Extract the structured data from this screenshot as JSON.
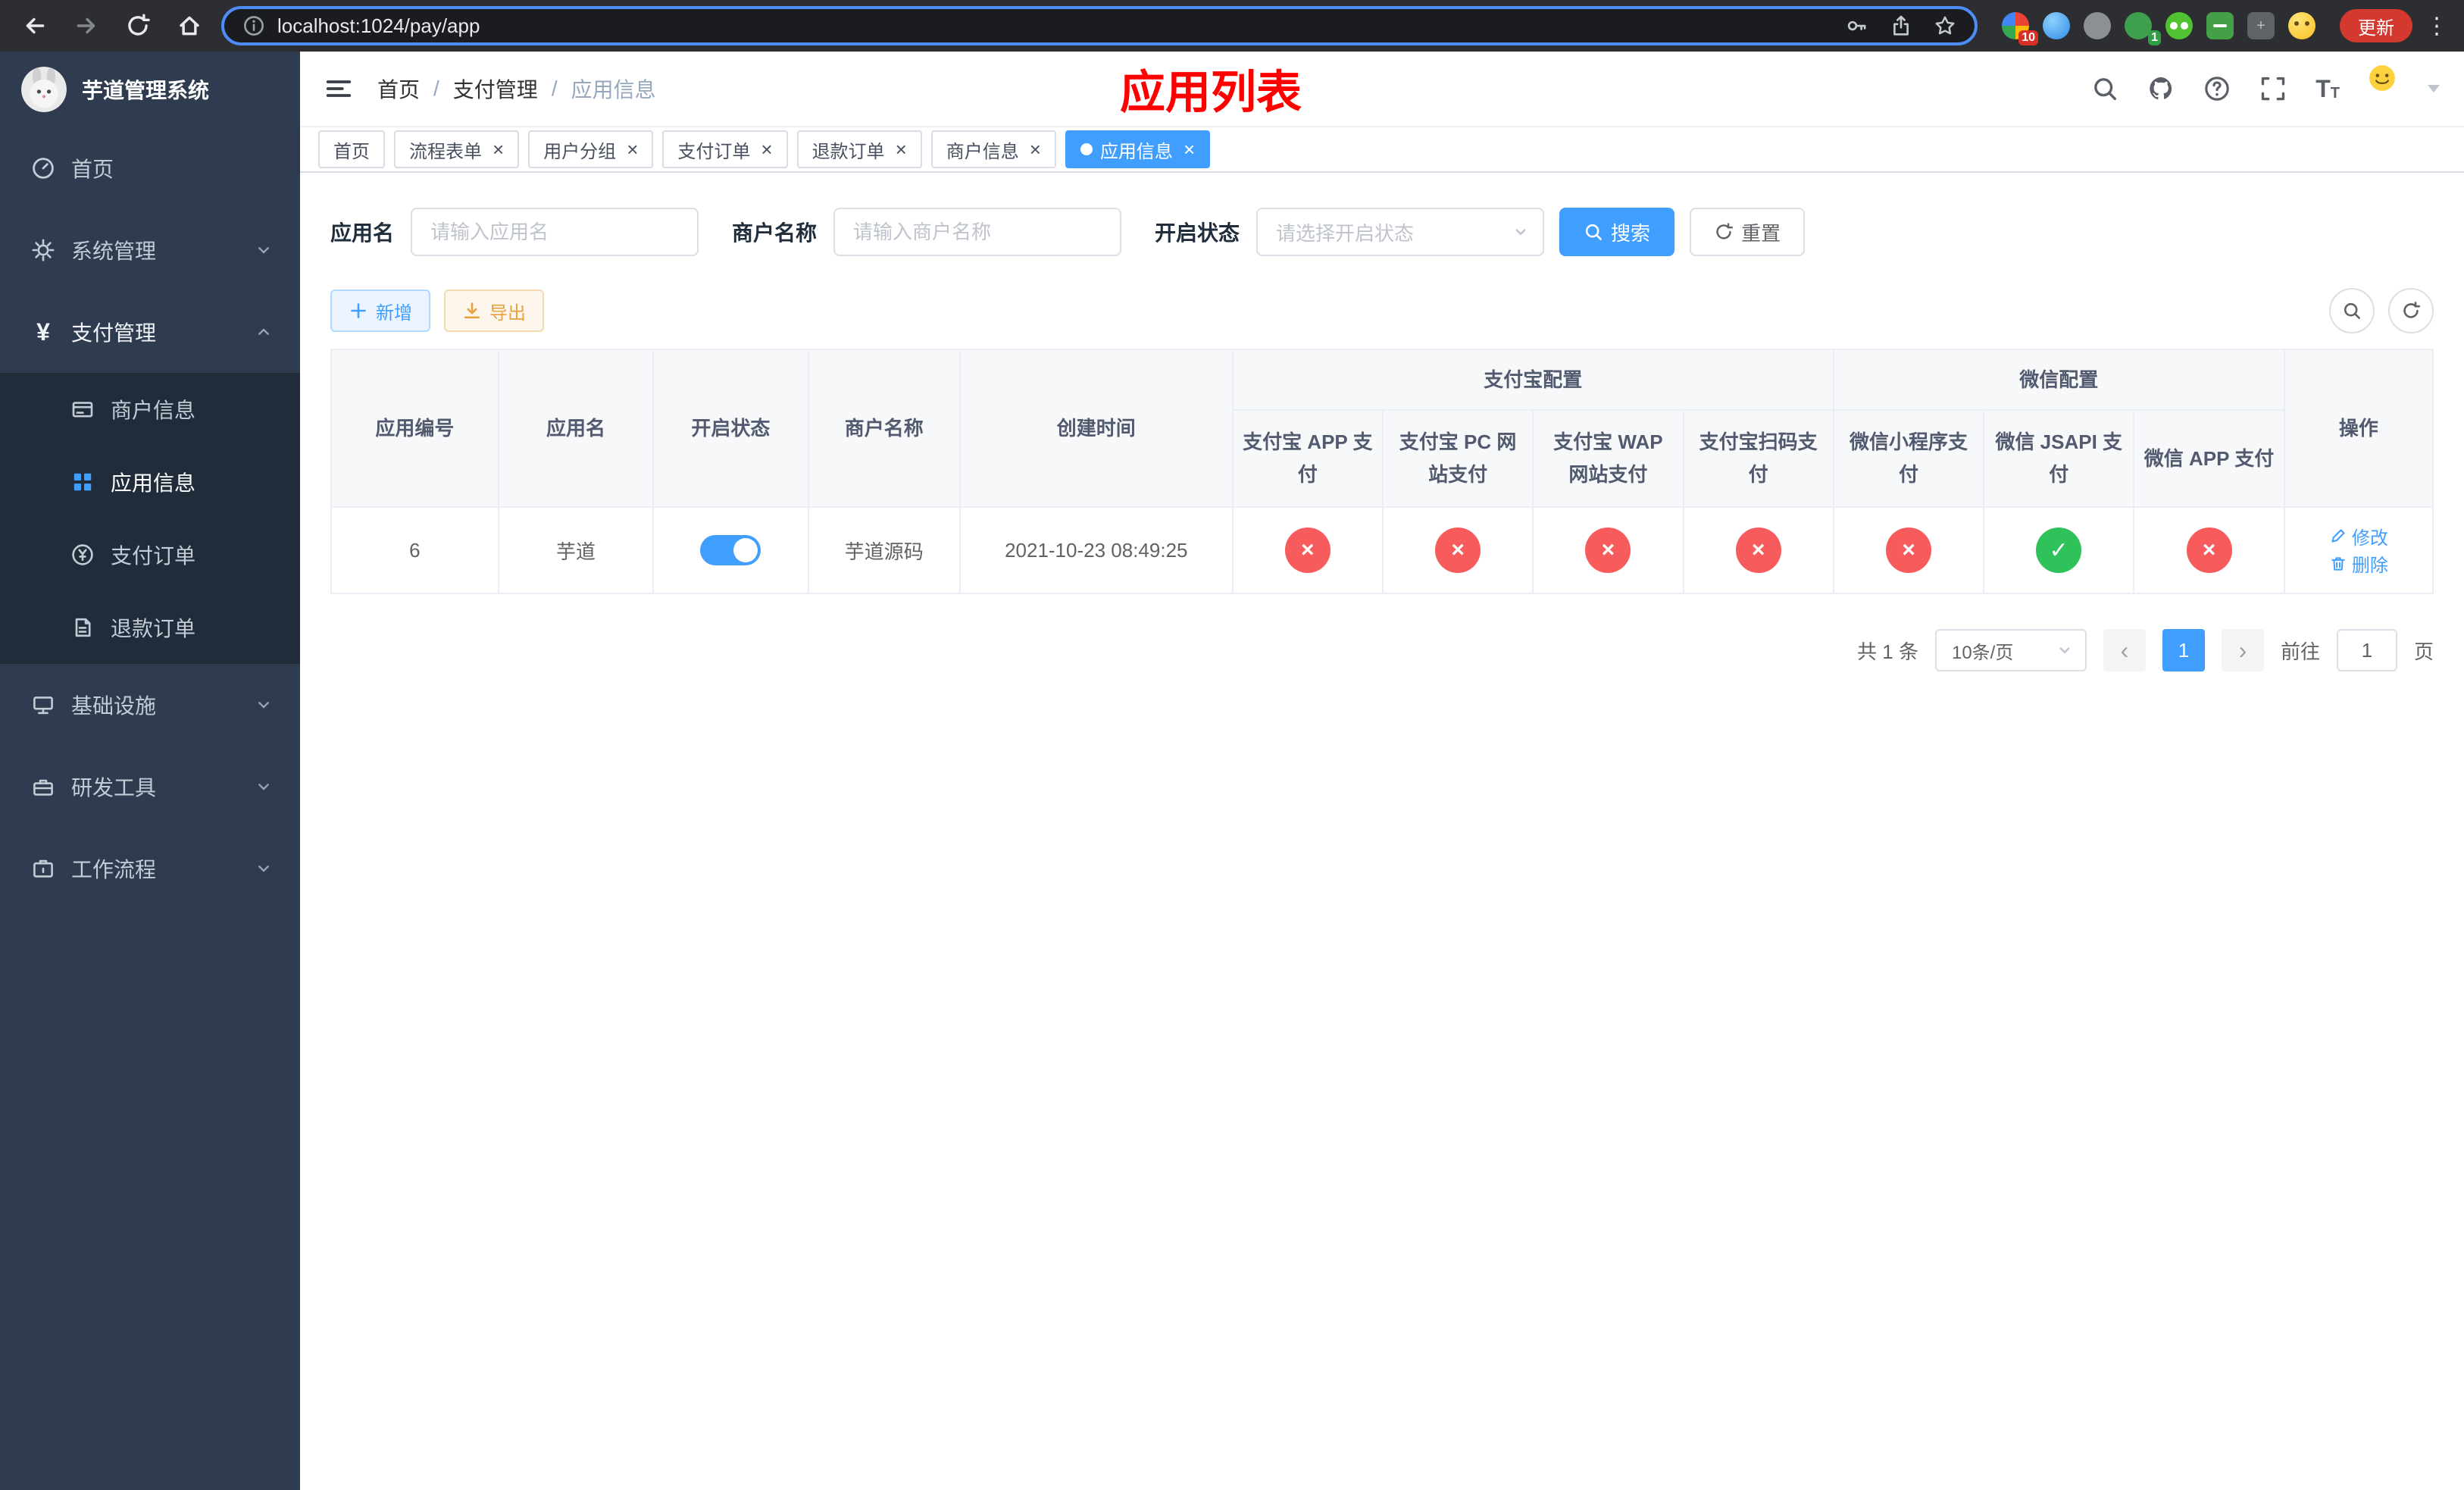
{
  "browser": {
    "url": "localhost:1024/pay/app",
    "update_label": "更新",
    "badges": [
      "10",
      "1"
    ]
  },
  "icons": {
    "close": "×",
    "check": "✓",
    "cross": "×",
    "prev": "‹",
    "next": "›",
    "kebab": "⋮",
    "puzzle": "+"
  },
  "sidebar": {
    "title": "芋道管理系统",
    "items": [
      {
        "label": "首页"
      },
      {
        "label": "系统管理"
      },
      {
        "label": "支付管理"
      },
      {
        "label": "基础设施"
      },
      {
        "label": "研发工具"
      },
      {
        "label": "工作流程"
      }
    ],
    "submenu": [
      {
        "label": "商户信息",
        "active": false
      },
      {
        "label": "应用信息",
        "active": true
      },
      {
        "label": "支付订单",
        "active": false
      },
      {
        "label": "退款订单",
        "active": false
      }
    ]
  },
  "header": {
    "breadcrumb": [
      "首页",
      "支付管理",
      "应用信息"
    ],
    "overlay_title": "应用列表"
  },
  "tabs": [
    {
      "label": "首页",
      "closable": false,
      "active": false
    },
    {
      "label": "流程表单",
      "closable": true,
      "active": false
    },
    {
      "label": "用户分组",
      "closable": true,
      "active": false
    },
    {
      "label": "支付订单",
      "closable": true,
      "active": false
    },
    {
      "label": "退款订单",
      "closable": true,
      "active": false
    },
    {
      "label": "商户信息",
      "closable": true,
      "active": false
    },
    {
      "label": "应用信息",
      "closable": true,
      "active": true
    }
  ],
  "filters": {
    "app_name_label": "应用名",
    "app_name_placeholder": "请输入应用名",
    "merchant_label": "商户名称",
    "merchant_placeholder": "请输入商户名称",
    "status_label": "开启状态",
    "status_placeholder": "请选择开启状态",
    "search_label": "搜索",
    "reset_label": "重置"
  },
  "toolbar": {
    "add_label": "新增",
    "export_label": "导出"
  },
  "table": {
    "headers": [
      "应用编号",
      "应用名",
      "开启状态",
      "商户名称",
      "创建时间"
    ],
    "groups": [
      {
        "label": "支付宝配置",
        "children": [
          "支付宝 APP 支付",
          "支付宝 PC 网站支付",
          "支付宝 WAP 网站支付",
          "支付宝扫码支付"
        ]
      },
      {
        "label": "微信配置",
        "children": [
          "微信小程序支付",
          "微信 JSAPI 支付",
          "微信 APP 支付"
        ]
      }
    ],
    "actions_header": "操作",
    "row": {
      "id": "6",
      "name": "芋道",
      "enabled": true,
      "merchant": "芋道源码",
      "created_at": "2021-10-23 08:49:25",
      "channels": [
        "no",
        "no",
        "no",
        "no",
        "no",
        "yes",
        "no"
      ],
      "edit_label": "修改",
      "delete_label": "删除"
    }
  },
  "pagination": {
    "total_label": "共 1 条",
    "page_size": "10条/页",
    "current_page": "1",
    "goto_label": "前往",
    "goto_value": "1",
    "page_unit": "页"
  },
  "colors": {
    "accent": "#409eff",
    "danger": "#f85b5b",
    "success": "#2fc25b",
    "title_red": "#ff0000"
  }
}
